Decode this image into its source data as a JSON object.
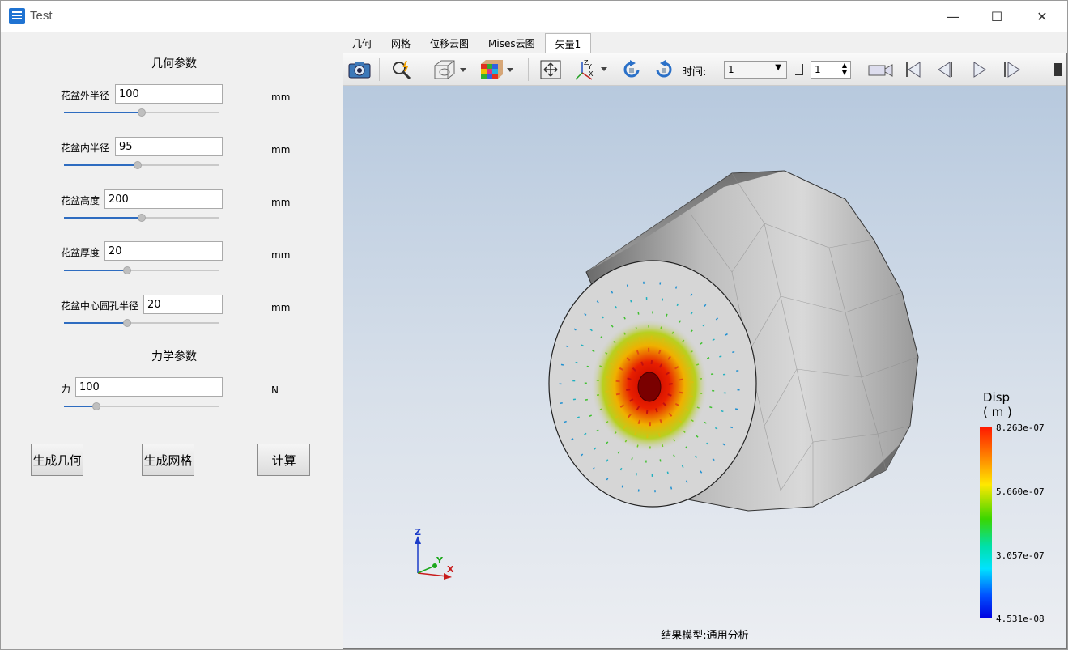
{
  "window": {
    "title": "Test",
    "minimize": "—",
    "maximize": "☐",
    "close": "✕"
  },
  "geometry": {
    "section_title": "几何参数",
    "params": [
      {
        "label": "花盆外半径",
        "value": "100",
        "unit": "mm",
        "slider_fraction": 0.5
      },
      {
        "label": "花盆内半径",
        "value": "95",
        "unit": "mm",
        "slider_fraction": 0.47
      },
      {
        "label": "花盆高度",
        "value": "200",
        "unit": "mm",
        "slider_fraction": 0.5
      },
      {
        "label": "花盆厚度",
        "value": "20",
        "unit": "mm",
        "slider_fraction": 0.4
      },
      {
        "label": "花盆中心圆孔半径",
        "value": "20",
        "unit": "mm",
        "slider_fraction": 0.4
      }
    ]
  },
  "mechanics": {
    "section_title": "力学参数",
    "params": [
      {
        "label": "力",
        "value": "100",
        "unit": "N",
        "slider_fraction": 0.19
      }
    ]
  },
  "buttons": {
    "gen_geometry": "生成几何",
    "gen_mesh": "生成网格",
    "compute": "计算"
  },
  "tabs": [
    {
      "label": "几何",
      "active": false
    },
    {
      "label": "网格",
      "active": false
    },
    {
      "label": "位移云图",
      "active": false
    },
    {
      "label": "Mises云图",
      "active": false
    },
    {
      "label": "矢量1",
      "active": true
    }
  ],
  "toolbar": {
    "time_label": "时间:",
    "time_value": "1",
    "step_value": "1",
    "icons": [
      "camera-icon",
      "zoom-icon",
      "view-mode-icon",
      "color-cube-icon",
      "fit-view-icon",
      "axes-icon",
      "rotate-cw-icon",
      "rotate-ccw-icon",
      "video-icon",
      "first-frame-icon",
      "prev-frame-icon",
      "play-icon",
      "next-frame-icon"
    ]
  },
  "legend": {
    "title_line1": "Disp",
    "title_line2": "( m )",
    "values": [
      "8.263e-07",
      "5.660e-07",
      "3.057e-07",
      "4.531e-08"
    ]
  },
  "axes": {
    "z": "Z",
    "y": "Y",
    "x": "X"
  },
  "footer": "结果模型:通用分析",
  "colors": {
    "accent": "#2e6cc0",
    "scene_top": "#b7c9de",
    "scene_bottom": "#eceef2"
  }
}
